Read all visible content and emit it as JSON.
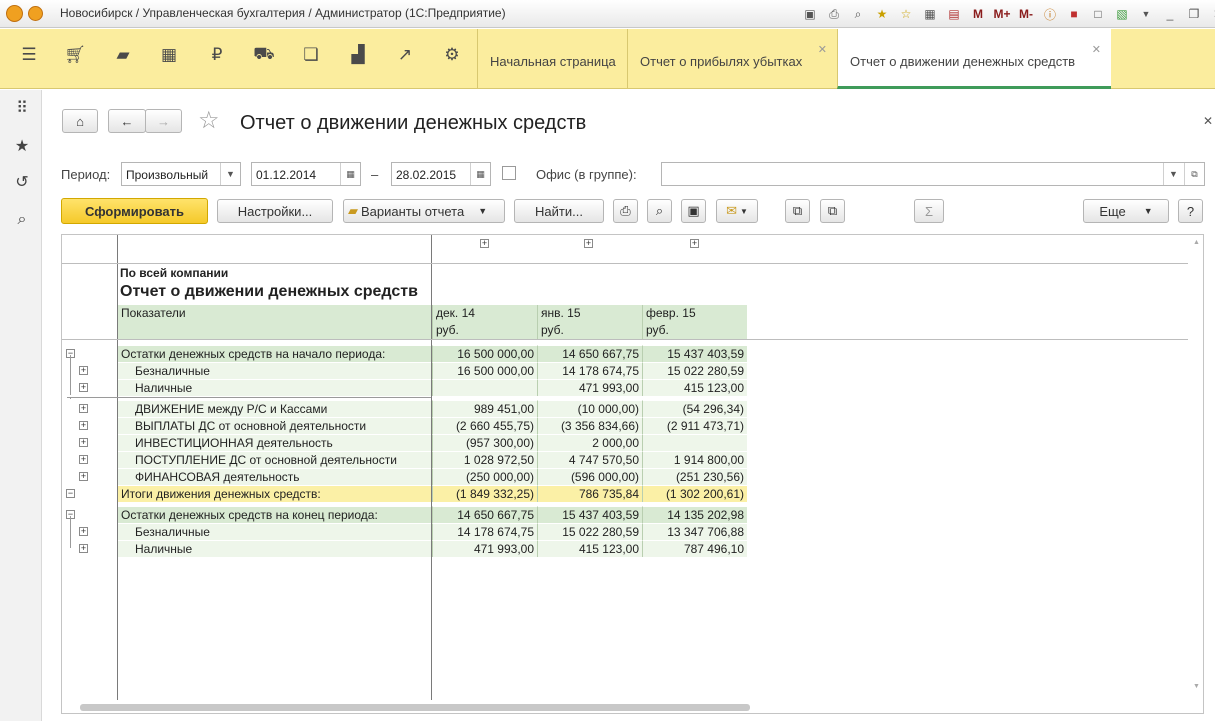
{
  "window": {
    "title": "Новосибирск / Управленческая бухгалтерия / Администратор  (1С:Предприятие)",
    "toolbar_labels": [
      "M",
      "M+",
      "M-"
    ]
  },
  "tabs": [
    {
      "label": "Начальная страница"
    },
    {
      "label": "Отчет о прибылях убытках"
    },
    {
      "label": "Отчет о движении денежных средств"
    }
  ],
  "page": {
    "title": "Отчет о движении денежных средств"
  },
  "filters": {
    "period_label": "Период:",
    "period_value": "Произвольный",
    "date_from": "01.12.2014",
    "dash": "–",
    "date_to": "28.02.2015",
    "office_label": "Офис (в группе):",
    "office_value": ""
  },
  "buttons": {
    "generate": "Сформировать",
    "settings": "Настройки...",
    "variants": "Варианты отчета",
    "find": "Найти...",
    "more": "Еще",
    "help": "?",
    "sum": "Σ"
  },
  "report": {
    "company_label": "По всей компании",
    "title": "Отчет о движении денежных средств",
    "indicators_header": "Показатели",
    "columns": [
      {
        "period": "дек. 14",
        "unit": "руб."
      },
      {
        "period": "янв. 15",
        "unit": "руб."
      },
      {
        "period": "февр. 15",
        "unit": "руб."
      }
    ],
    "rows": [
      {
        "label": "Остатки денежных средств на начало периода:",
        "values": [
          "16 500 000,00",
          "14 650 667,75",
          "15 437 403,59"
        ]
      },
      {
        "label": "Безналичные",
        "values": [
          "16 500 000,00",
          "14 178 674,75",
          "15 022 280,59"
        ]
      },
      {
        "label": "Наличные",
        "values": [
          "",
          "471 993,00",
          "415 123,00"
        ]
      },
      {
        "label": "ДВИЖЕНИЕ между Р/С и Кассами",
        "values": [
          "989 451,00",
          "(10 000,00)",
          "(54 296,34)"
        ]
      },
      {
        "label": "ВЫПЛАТЫ ДС от основной деятельности",
        "values": [
          "(2 660 455,75)",
          "(3 356 834,66)",
          "(2 911 473,71)"
        ]
      },
      {
        "label": "ИНВЕСТИЦИОННАЯ деятельность",
        "values": [
          "(957 300,00)",
          "2 000,00",
          ""
        ]
      },
      {
        "label": "ПОСТУПЛЕНИЕ ДС от основной деятельности",
        "values": [
          "1 028 972,50",
          "4 747 570,50",
          "1 914 800,00"
        ]
      },
      {
        "label": "ФИНАНСОВАЯ деятельность",
        "values": [
          "(250 000,00)",
          "(596 000,00)",
          "(251 230,56)"
        ]
      },
      {
        "label": "Итоги движения денежных средств:",
        "values": [
          "(1 849 332,25)",
          "786 735,84",
          "(1 302 200,61)"
        ]
      },
      {
        "label": "Остатки денежных средств на конец периода:",
        "values": [
          "14 650 667,75",
          "15 437 403,59",
          "14 135 202,98"
        ]
      },
      {
        "label": "Безналичные",
        "values": [
          "14 178 674,75",
          "15 022 280,59",
          "13 347 706,88"
        ]
      },
      {
        "label": "Наличные",
        "values": [
          "471 993,00",
          "415 123,00",
          "787 496,10"
        ]
      }
    ]
  },
  "colors": {
    "command_bar": "#fbed9e",
    "group_row": "#d9ead3",
    "detail_row": "#eef6ea",
    "total_row": "#fbf0a6",
    "active_tab_underline": "#3f9b5a"
  }
}
